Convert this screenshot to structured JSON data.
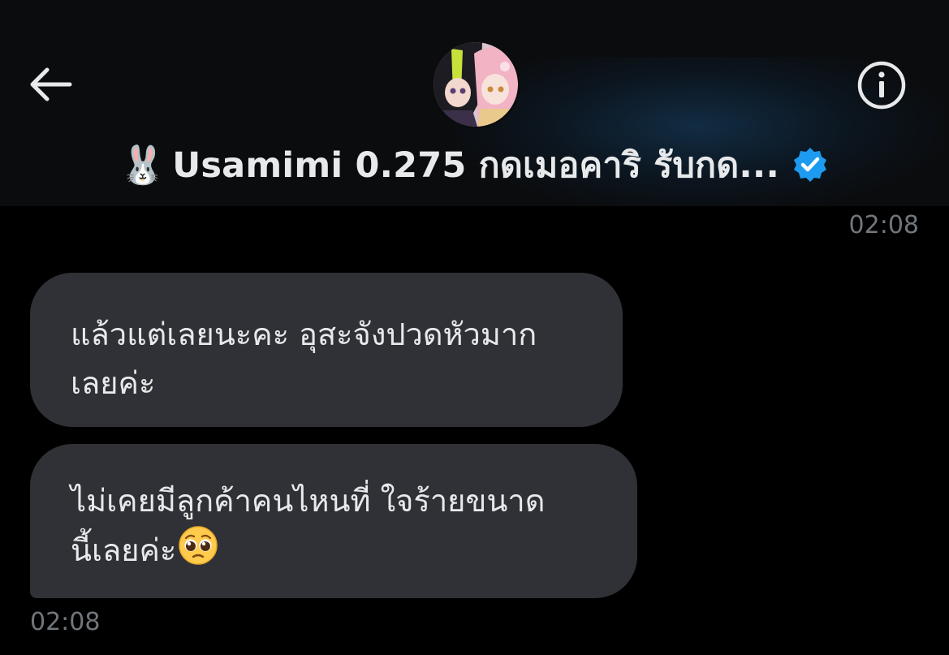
{
  "header": {
    "back_icon": "arrow-left-icon",
    "info_icon": "info-circle-icon",
    "avatar_icon": "avatar-anime-characters",
    "title_emoji": "🐰",
    "title_name": "Usamimi 0.275 กดเมอคาริ รับกด...",
    "verified_icon": "verified-badge-icon",
    "accent_color": "#1d9bf0"
  },
  "messages": [
    {
      "timestamp": "02:08"
    },
    {
      "lines": [
        "แล้วแต่เลยนะคะ อุสะจังปวดหัวมาก",
        "เลยค่ะ"
      ]
    },
    {
      "lines": [
        "ไม่เคยมีลูกค้าคนไหนที่ ใจร้ายขนาด",
        "นี้เลยค่ะ"
      ],
      "trailing_emoji": "pleading-face-emoji"
    }
  ],
  "footer": {
    "timestamp": "02:08"
  },
  "colors": {
    "background": "#000000",
    "header_bg": "#0b0c0e",
    "bubble_bg": "#2f3136",
    "text": "#e7e9ea",
    "muted_text": "#71767b"
  }
}
